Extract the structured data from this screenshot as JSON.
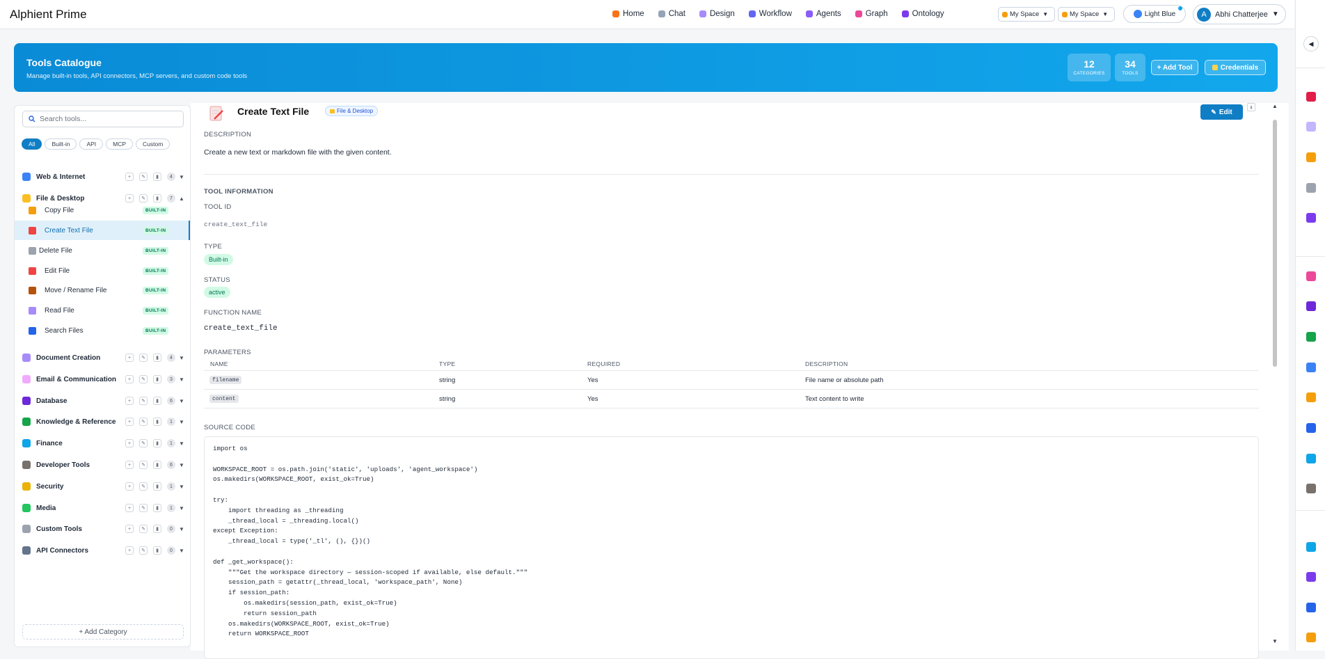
{
  "app": {
    "title": "Alphient Prime"
  },
  "nav": [
    {
      "label": "Home",
      "icon": "home-icon",
      "color": "#f97316"
    },
    {
      "label": "Chat",
      "icon": "chat-icon",
      "color": "#94a3b8"
    },
    {
      "label": "Design",
      "icon": "design-icon",
      "color": "#a78bfa"
    },
    {
      "label": "Workflow",
      "icon": "workflow-icon",
      "color": "#6366f1"
    },
    {
      "label": "Agents",
      "icon": "agents-icon",
      "color": "#8b5cf6"
    },
    {
      "label": "Graph",
      "icon": "graph-icon",
      "color": "#ec4899"
    },
    {
      "label": "Ontology",
      "icon": "ontology-icon",
      "color": "#7c3aed"
    }
  ],
  "spaces": [
    {
      "label": "My Space"
    },
    {
      "label": "My Space"
    }
  ],
  "theme": {
    "label": "Light Blue"
  },
  "user": {
    "initial": "A",
    "name": "Abhi Chatterjee"
  },
  "hero": {
    "title": "Tools Catalogue",
    "subtitle": "Manage built-in tools, API connectors, MCP servers, and custom code tools",
    "stats": [
      {
        "value": "12",
        "label": "CATEGORIES"
      },
      {
        "value": "34",
        "label": "TOOLS"
      }
    ],
    "add_tool_label": "+ Add Tool",
    "credentials_label": "Credentials"
  },
  "sidebar": {
    "search_placeholder": "Search tools...",
    "filters": [
      "All",
      "Built-in",
      "API",
      "MCP",
      "Custom"
    ],
    "active_filter": "All",
    "categories": [
      {
        "name": "Web & Internet",
        "count": "4",
        "expanded": false,
        "icon_color": "#3b82f6"
      },
      {
        "name": "File & Desktop",
        "count": "7",
        "expanded": true,
        "icon_color": "#fbbf24",
        "tools": [
          {
            "name": "Copy File",
            "badge": "BUILT-IN",
            "icon_color": "#f59e0b"
          },
          {
            "name": "Create Text File",
            "badge": "BUILT-IN",
            "icon_color": "#ef4444",
            "selected": true
          },
          {
            "name": "Delete File",
            "badge": "BUILT-IN",
            "icon_color": "#9ca3af"
          },
          {
            "name": "Edit File",
            "badge": "BUILT-IN",
            "icon_color": "#ef4444"
          },
          {
            "name": "Move / Rename File",
            "badge": "BUILT-IN",
            "icon_color": "#b45309"
          },
          {
            "name": "Read File",
            "badge": "BUILT-IN",
            "icon_color": "#a78bfa"
          },
          {
            "name": "Search Files",
            "badge": "BUILT-IN",
            "icon_color": "#2563eb"
          }
        ]
      },
      {
        "name": "Document Creation",
        "count": "4",
        "expanded": false,
        "icon_color": "#a78bfa"
      },
      {
        "name": "Email & Communication",
        "count": "3",
        "expanded": false,
        "icon_color": "#f0abfc"
      },
      {
        "name": "Database",
        "count": "6",
        "expanded": false,
        "icon_color": "#6d28d9"
      },
      {
        "name": "Knowledge & Reference",
        "count": "1",
        "expanded": false,
        "icon_color": "#16a34a"
      },
      {
        "name": "Finance",
        "count": "1",
        "expanded": false,
        "icon_color": "#0ea5e9"
      },
      {
        "name": "Developer Tools",
        "count": "6",
        "expanded": false,
        "icon_color": "#78716c"
      },
      {
        "name": "Security",
        "count": "1",
        "expanded": false,
        "icon_color": "#eab308"
      },
      {
        "name": "Media",
        "count": "1",
        "expanded": false,
        "icon_color": "#22c55e"
      },
      {
        "name": "Custom Tools",
        "count": "0",
        "expanded": false,
        "icon_color": "#9ca3af"
      },
      {
        "name": "API Connectors",
        "count": "0",
        "expanded": false,
        "icon_color": "#64748b"
      }
    ],
    "add_category_label": "+ Add Category"
  },
  "detail": {
    "title": "Create Text File",
    "category_badge": "File & Desktop",
    "edit_label": "Edit",
    "description_label": "DESCRIPTION",
    "description": "Create a new text or markdown file with the given content.",
    "info_label": "TOOL INFORMATION",
    "tool_id_label": "TOOL ID",
    "tool_id": "create_text_file",
    "type_label": "TYPE",
    "type": "Built-in",
    "status_label": "STATUS",
    "status": "active",
    "function_name_label": "FUNCTION NAME",
    "function_name": "create_text_file",
    "parameters_label": "PARAMETERS",
    "param_headers": [
      "NAME",
      "TYPE",
      "REQUIRED",
      "DESCRIPTION"
    ],
    "params": [
      {
        "name": "filename",
        "type": "string",
        "required": "Yes",
        "description": "File name or absolute path"
      },
      {
        "name": "content",
        "type": "string",
        "required": "Yes",
        "description": "Text content to write"
      }
    ],
    "source_label": "SOURCE CODE",
    "source_code": "import os\n\nWORKSPACE_ROOT = os.path.join('static', 'uploads', 'agent_workspace')\nos.makedirs(WORKSPACE_ROOT, exist_ok=True)\n\ntry:\n    import threading as _threading\n    _thread_local = _threading.local()\nexcept Exception:\n    _thread_local = type('_tl', (), {})()\n\ndef _get_workspace():\n    \"\"\"Get the workspace directory — session-scoped if available, else default.\"\"\"\n    session_path = getattr(_thread_local, 'workspace_path', None)\n    if session_path:\n        os.makedirs(session_path, exist_ok=True)\n        return session_path\n    os.makedirs(WORKSPACE_ROOT, exist_ok=True)\n    return WORKSPACE_ROOT"
  },
  "rail_icons": [
    {
      "name": "target-icon",
      "color": "#e11d48"
    },
    {
      "name": "document-icon",
      "color": "#c4b5fd"
    },
    {
      "name": "clipboard-icon",
      "color": "#f59e0b"
    },
    {
      "name": "gear-icon",
      "color": "#9ca3af"
    },
    {
      "name": "robot-icon",
      "color": "#7c3aed"
    },
    {
      "name": "brain-icon",
      "color": "#ec4899"
    },
    {
      "name": "bot-face-icon",
      "color": "#6d28d9"
    },
    {
      "name": "books-icon",
      "color": "#16a34a"
    },
    {
      "name": "book-icon",
      "color": "#3b82f6"
    },
    {
      "name": "notes-icon",
      "color": "#f59e0b"
    },
    {
      "name": "shield-icon",
      "color": "#2563eb"
    },
    {
      "name": "bag-icon",
      "color": "#0ea5e9"
    },
    {
      "name": "tools-icon",
      "color": "#78716c"
    },
    {
      "name": "globe-icon",
      "color": "#0ea5e9"
    },
    {
      "name": "save-icon",
      "color": "#7c3aed"
    },
    {
      "name": "chart-icon",
      "color": "#2563eb"
    },
    {
      "name": "scales-icon",
      "color": "#f59e0b"
    }
  ]
}
